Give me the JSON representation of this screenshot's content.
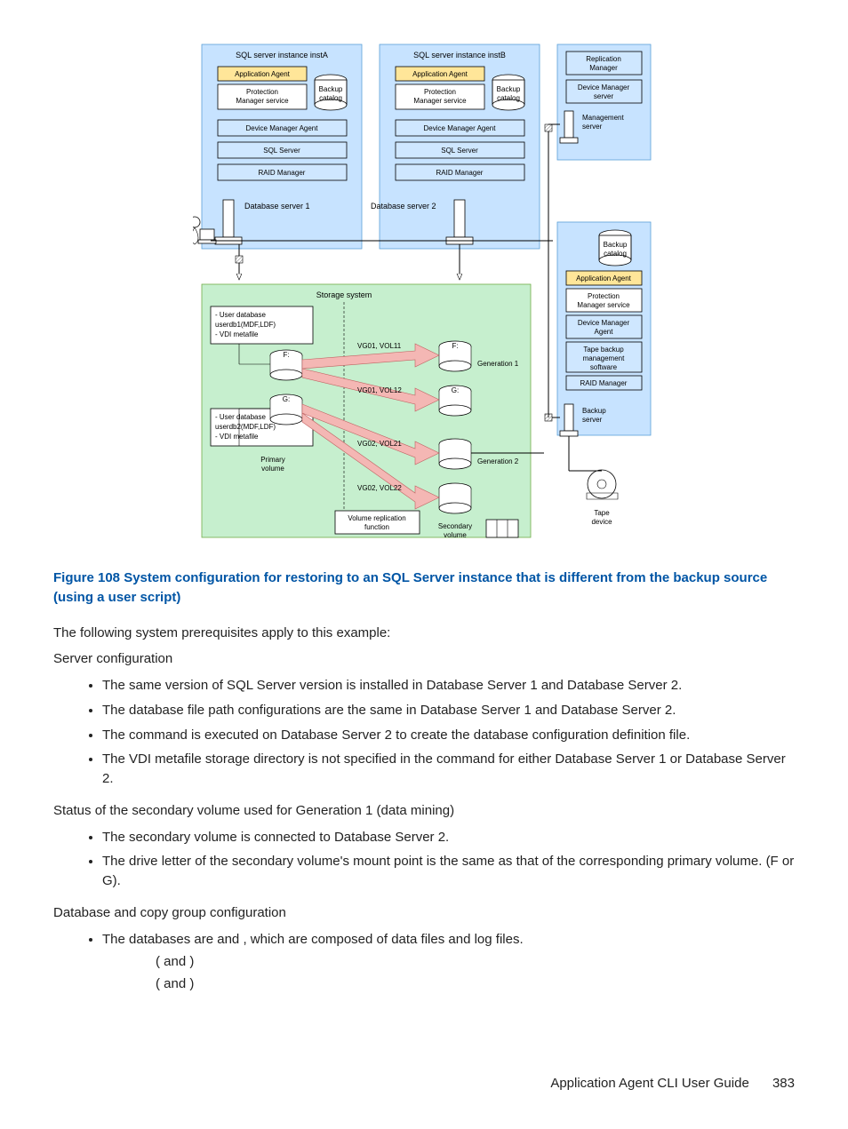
{
  "diagram": {
    "instA": "SQL server instance instA",
    "instB": "SQL server instance instB",
    "appAgent": "Application Agent",
    "pmService": "Protection Manager service",
    "backupCatalog": "Backup catalog",
    "dmAgent": "Device Manager Agent",
    "sqlServer": "SQL Server",
    "raidManager": "RAID Manager",
    "dbServer1": "Database server 1",
    "dbServer2": "Database server 2",
    "replicationManager": "Replication Manager",
    "dmServer": "Device Manager server",
    "managementServer": "Management server",
    "backupServer": "Backup server",
    "tapeSw1": "Tape backup",
    "tapeSw2": "management",
    "tapeSw3": "software",
    "tapeDevice": "Tape device",
    "storageSystem": "Storage system",
    "userdb1a": "- User database",
    "userdb1b": "userdb1(MDF,LDF)",
    "userdb1c": "- VDI metafile",
    "userdb2a": "- User database",
    "userdb2b": "userdb2(MDF,LDF)",
    "userdb2c": "- VDI metafile",
    "volF": "F:",
    "volG": "G:",
    "vg11": "VG01, VOL11",
    "vg12": "VG01, VOL12",
    "vg21": "VG02, VOL21",
    "vg22": "VG02, VOL22",
    "gen1": "Generation 1",
    "gen2": "Generation 2",
    "primaryVol": "Primary volume",
    "secondaryVol": "Secondary volume",
    "vrf1": "Volume replication",
    "vrf2": "function"
  },
  "caption": "Figure 108 System configuration for restoring to an SQL Server instance that is different from the backup source (using a user script)",
  "intro": "The following system prerequisites apply to this example:",
  "section1": "Server configuration",
  "bullets1": [
    "The same version of SQL Server version is installed in Database Server 1 and Database Server 2.",
    "The database file path configurations are the same in Database Server 1 and Database Server 2.",
    "The                       command is executed on Database Server 2 to create the database configuration definition file.",
    "The VDI metafile storage directory is not specified in the                           command for either Database Server 1 or Database Server 2."
  ],
  "section2": "Status of the secondary volume used for Generation 1 (data mining)",
  "bullets2": [
    "The secondary volume is connected to Database Server 2.",
    "The drive letter of the secondary volume's mount point is the same as that of the corresponding primary volume. (F or G)."
  ],
  "section3": "Database and copy group configuration",
  "bullet3": "The databases are              and              , which are composed of data files and log files.",
  "sub1": "(                                         and                                                      )",
  "sub2": "(                                         and                                                      )",
  "footer": {
    "title": "Application Agent CLI User Guide",
    "page": "383"
  }
}
